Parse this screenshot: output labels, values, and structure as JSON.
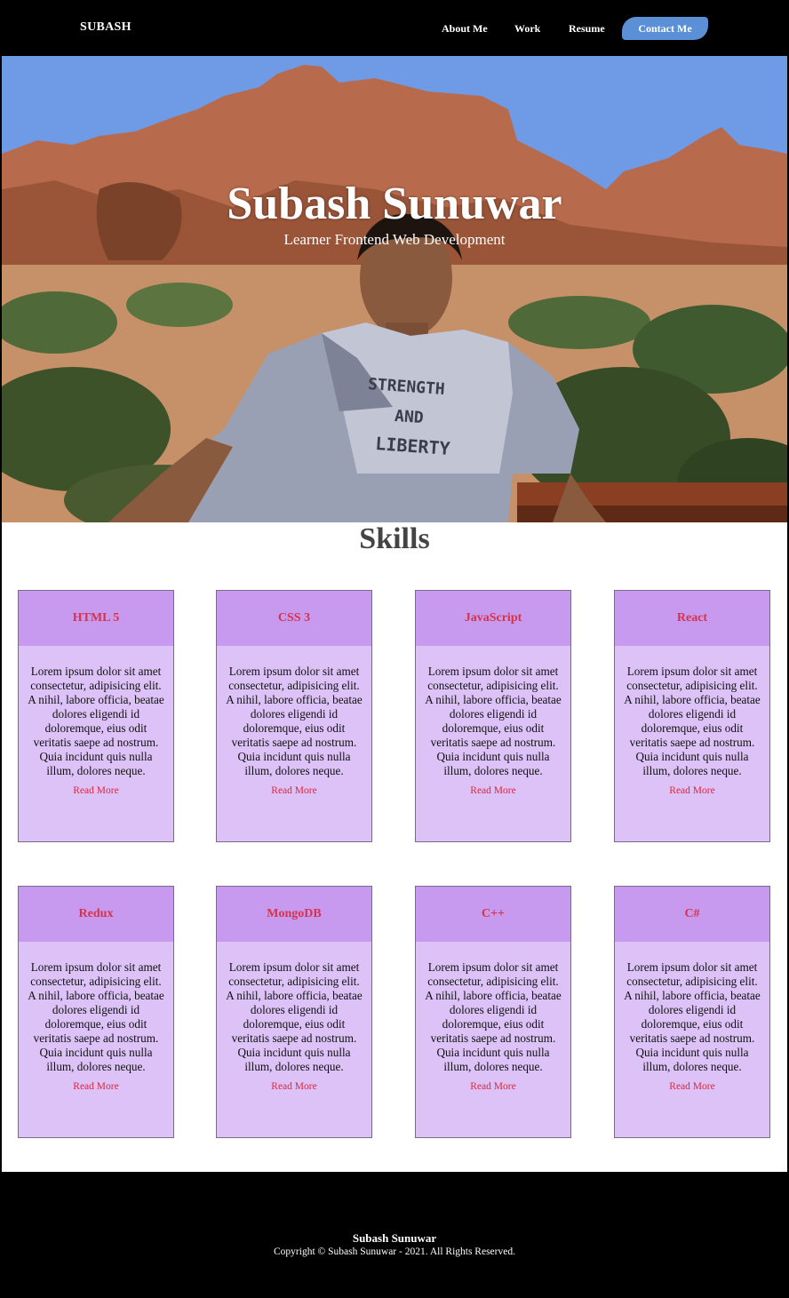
{
  "nav": {
    "brand": "SUBASH",
    "links": [
      "About Me",
      "Work",
      "Resume"
    ],
    "contact": "Contact Me"
  },
  "hero": {
    "title": "Subash Sunuwar",
    "subtitle": "Learner Frontend Web Development",
    "shirt_text": [
      "STRENGTH",
      "AND",
      "LIBERTY"
    ]
  },
  "skills": {
    "title": "Skills",
    "cards": [
      {
        "name": "HTML 5",
        "text": "Lorem ipsum dolor sit amet consectetur, adipisicing elit. A nihil, labore officia, beatae dolores eligendi id doloremque, eius odit veritatis saepe ad nostrum. Quia incidunt quis nulla illum, dolores neque.",
        "link": "Read More"
      },
      {
        "name": "CSS 3",
        "text": "Lorem ipsum dolor sit amet consectetur, adipisicing elit. A nihil, labore officia, beatae dolores eligendi id doloremque, eius odit veritatis saepe ad nostrum. Quia incidunt quis nulla illum, dolores neque.",
        "link": "Read More"
      },
      {
        "name": "JavaScript",
        "text": "Lorem ipsum dolor sit amet consectetur, adipisicing elit. A nihil, labore officia, beatae dolores eligendi id doloremque, eius odit veritatis saepe ad nostrum. Quia incidunt quis nulla illum, dolores neque.",
        "link": "Read More"
      },
      {
        "name": "React",
        "text": "Lorem ipsum dolor sit amet consectetur, adipisicing elit. A nihil, labore officia, beatae dolores eligendi id doloremque, eius odit veritatis saepe ad nostrum. Quia incidunt quis nulla illum, dolores neque.",
        "link": "Read More"
      },
      {
        "name": "Redux",
        "text": "Lorem ipsum dolor sit amet consectetur, adipisicing elit. A nihil, labore officia, beatae dolores eligendi id doloremque, eius odit veritatis saepe ad nostrum. Quia incidunt quis nulla illum, dolores neque.",
        "link": "Read More"
      },
      {
        "name": "MongoDB",
        "text": "Lorem ipsum dolor sit amet consectetur, adipisicing elit. A nihil, labore officia, beatae dolores eligendi id doloremque, eius odit veritatis saepe ad nostrum. Quia incidunt quis nulla illum, dolores neque.",
        "link": "Read More"
      },
      {
        "name": "C++",
        "text": "Lorem ipsum dolor sit amet consectetur, adipisicing elit. A nihil, labore officia, beatae dolores eligendi id doloremque, eius odit veritatis saepe ad nostrum. Quia incidunt quis nulla illum, dolores neque.",
        "link": "Read More"
      },
      {
        "name": "C#",
        "text": "Lorem ipsum dolor sit amet consectetur, adipisicing elit. A nihil, labore officia, beatae dolores eligendi id doloremque, eius odit veritatis saepe ad nostrum. Quia incidunt quis nulla illum, dolores neque.",
        "link": "Read More"
      }
    ]
  },
  "footer": {
    "name": "Subash Sunuwar",
    "copyright": "Copyright © Subash Sunuwar - 2021. All Rights Reserved."
  },
  "colors": {
    "nav_bg": "#000000",
    "contact_button": "#5b8fd6",
    "card_head": "#c79af0",
    "card_body": "#dcc2f7",
    "card_title": "#d6334a",
    "read_more": "#e0263f"
  }
}
